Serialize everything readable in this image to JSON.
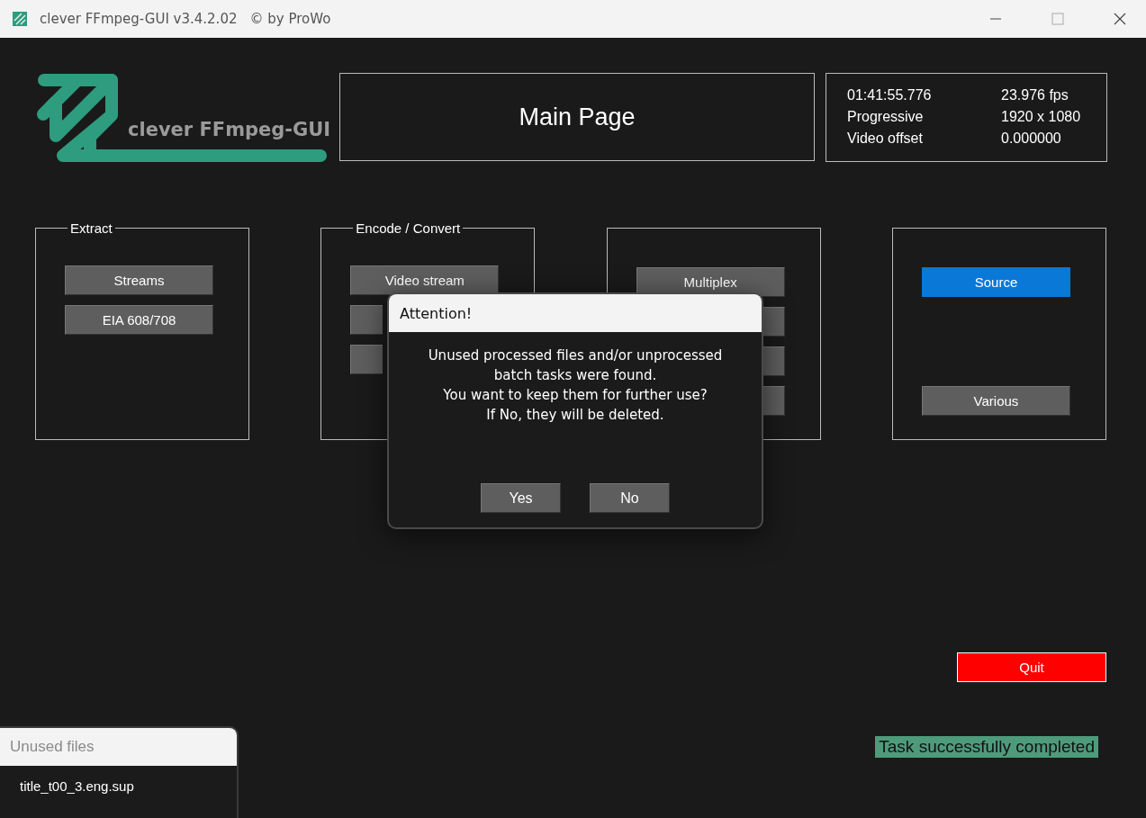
{
  "window": {
    "title": "clever FFmpeg-GUI v3.4.2.02",
    "copyright": "© by ProWo"
  },
  "logo": {
    "text": "clever FFmpeg-GUI"
  },
  "page_title": "Main Page",
  "info": [
    {
      "label": "01:41:55.776",
      "value": "23.976 fps"
    },
    {
      "label": "Progressive",
      "value": "1920 x 1080"
    },
    {
      "label": "Video offset",
      "value": "0.000000"
    }
  ],
  "groups": [
    {
      "legend": "Extract",
      "buttons": [
        {
          "label": "Streams",
          "selected": false
        },
        {
          "label": "EIA 608/708",
          "selected": false
        }
      ]
    },
    {
      "legend": "Encode / Convert",
      "buttons": [
        {
          "label": "Video stream",
          "selected": false
        },
        {
          "selected": false
        },
        {
          "selected": false
        }
      ]
    },
    {
      "buttons": [
        {
          "label": "Multiplex",
          "selected": false
        },
        {
          "selected": false
        },
        {
          "selected": false
        },
        {
          "selected": false
        }
      ]
    },
    {
      "buttons": [
        {
          "label": "Source",
          "selected": true
        },
        {
          "label": "Various",
          "selected": false
        }
      ]
    }
  ],
  "quit_button": "Quit",
  "status": "Task successfully completed",
  "dialog": {
    "title": "Attention!",
    "message": "Unused processed files and/or unprocessed\nbatch tasks were found.\nYou want to keep them for further use?\nIf No, they will be deleted.",
    "buttons": [
      "Yes",
      "No"
    ]
  },
  "unused_files": {
    "title": "Unused files",
    "items": [
      "title_t00_3.eng.sup"
    ]
  }
}
